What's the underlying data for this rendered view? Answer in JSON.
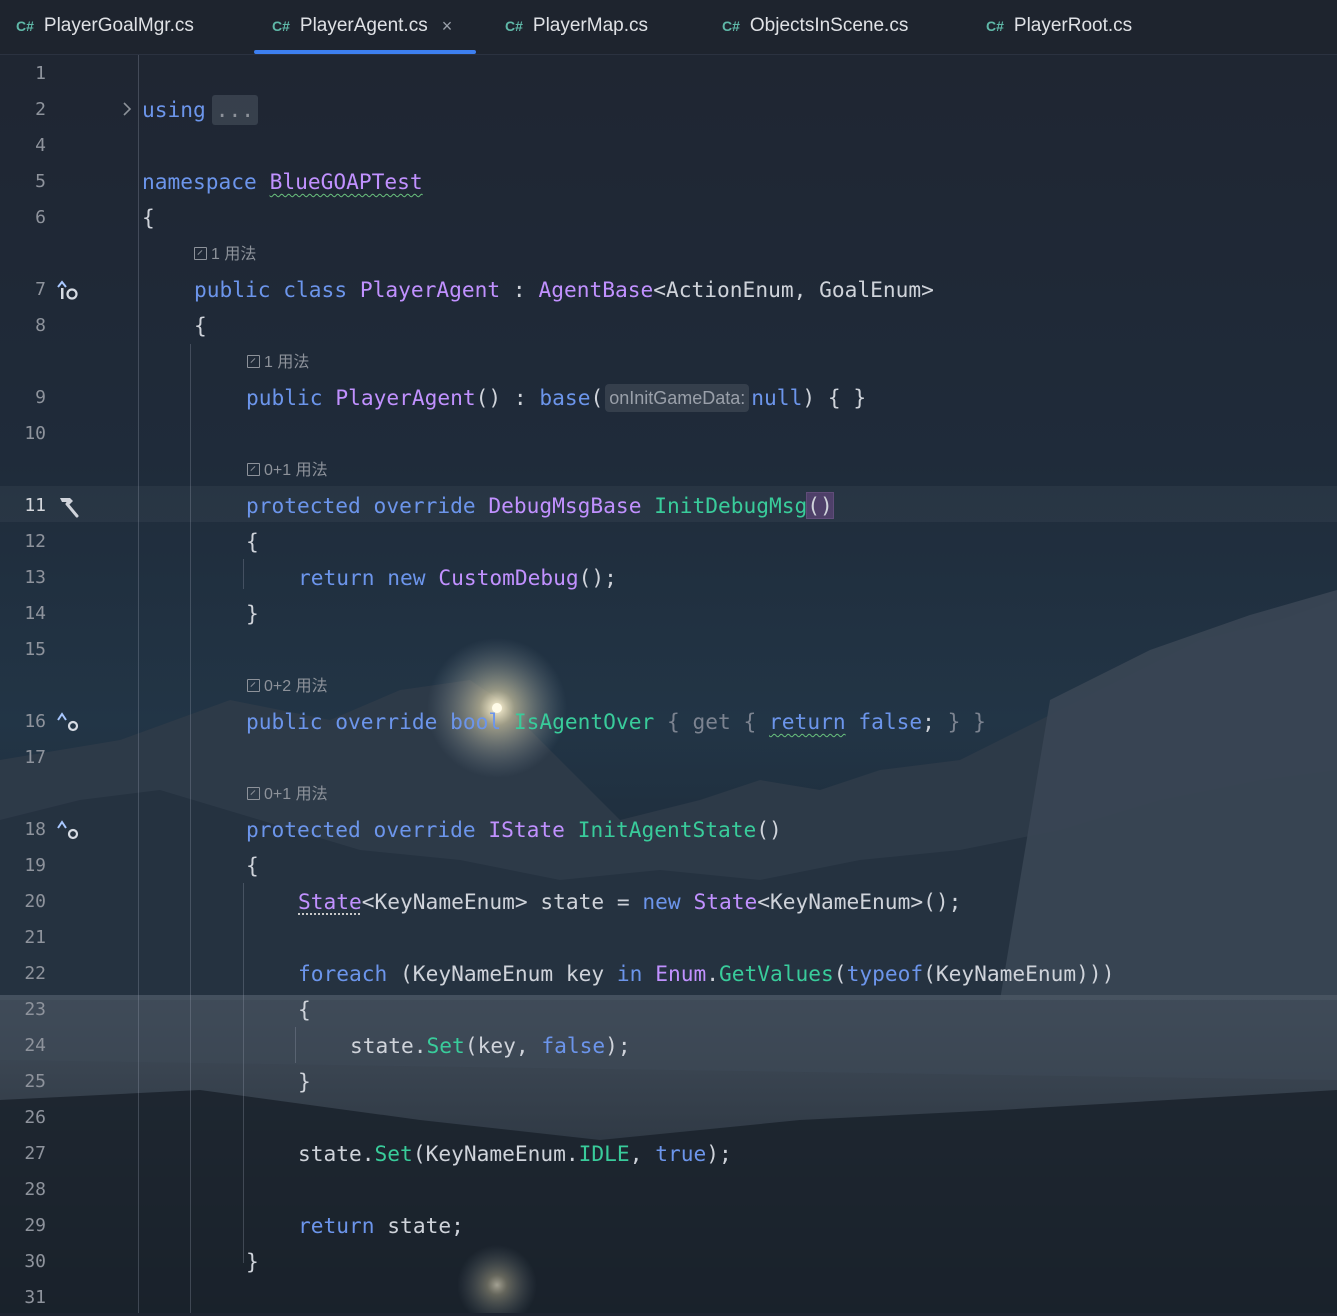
{
  "tabs": [
    {
      "lang": "C#",
      "label": "PlayerGoalMgr.cs",
      "active": false
    },
    {
      "lang": "C#",
      "label": "PlayerAgent.cs",
      "active": true,
      "close": "×"
    },
    {
      "lang": "C#",
      "label": "PlayerMap.cs",
      "active": false
    },
    {
      "lang": "C#",
      "label": "ObjectsInScene.cs",
      "active": false
    },
    {
      "lang": "C#",
      "label": "PlayerRoot.cs",
      "active": false
    }
  ],
  "line_numbers": [
    "1",
    "2",
    "4",
    "5",
    "6",
    "7",
    "8",
    "9",
    "10",
    "11",
    "12",
    "13",
    "14",
    "15",
    "16",
    "17",
    "18",
    "19",
    "20",
    "21",
    "22",
    "23",
    "24",
    "25",
    "26",
    "27",
    "28",
    "29",
    "30",
    "31"
  ],
  "usage_hints": {
    "class": "1 用法",
    "ctor": "1 用法",
    "debug": "0+1 用法",
    "isover": "0+2 用法",
    "initstate": "0+1 用法"
  },
  "param_hint": "onInitGameData:",
  "fold_placeholder": "...",
  "gutter_icons": [
    "implements-override-icon",
    "hammer-icon",
    "override-icon",
    "override-icon"
  ],
  "theme": {
    "keyword": "#6c95eb",
    "type": "#c191ff",
    "method": "#39cc9b",
    "accent": "#3d7ff0"
  }
}
